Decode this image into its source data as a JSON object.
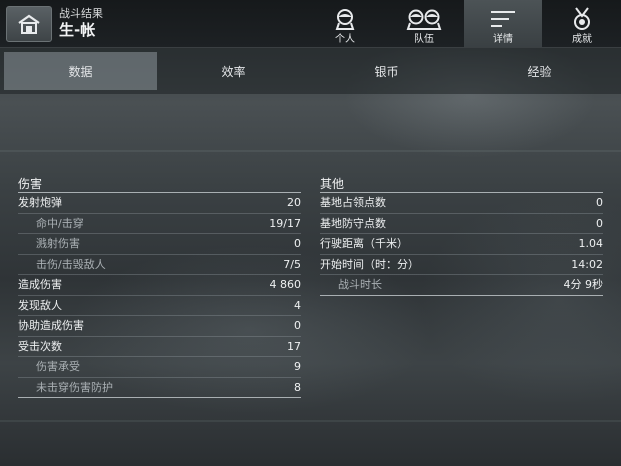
{
  "header": {
    "subtitle": "战斗结果",
    "title": "生-帐",
    "nav": [
      {
        "label": "个人",
        "icon": "person-icon"
      },
      {
        "label": "队伍",
        "icon": "team-icon"
      },
      {
        "label": "详情",
        "icon": "details-icon"
      },
      {
        "label": "成就",
        "icon": "medal-icon"
      }
    ]
  },
  "tabs": [
    "数据",
    "效率",
    "银币",
    "经验"
  ],
  "left": {
    "title": "伤害",
    "rows": [
      {
        "k": "发射炮弹",
        "v": "20"
      },
      {
        "k": "命中/击穿",
        "v": "19/17"
      },
      {
        "k": "溅射伤害",
        "v": "0"
      },
      {
        "k": "击伤/击毁敌人",
        "v": "7/5"
      },
      {
        "k": "造成伤害",
        "v": "4 860"
      },
      {
        "k": "发现敌人",
        "v": "4"
      },
      {
        "k": "协助造成伤害",
        "v": "0"
      },
      {
        "k": "受击次数",
        "v": "17"
      },
      {
        "k": "伤害承受",
        "v": "9"
      },
      {
        "k": "未击穿伤害防护",
        "v": "8"
      }
    ]
  },
  "right": {
    "title": "其他",
    "rows": [
      {
        "k": "基地占领点数",
        "v": "0"
      },
      {
        "k": "基地防守点数",
        "v": "0"
      },
      {
        "k": "行驶距离（千米）",
        "v": "1.04"
      },
      {
        "k": "开始时间（时：分）",
        "v": "14:02"
      },
      {
        "k": "战斗时长",
        "v": "4分 9秒"
      }
    ]
  }
}
